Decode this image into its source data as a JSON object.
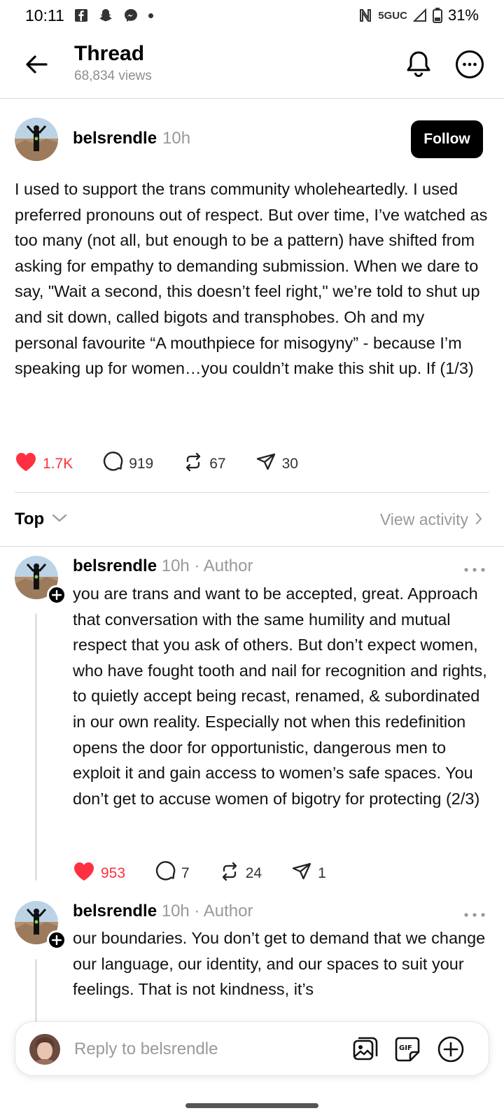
{
  "status_bar": {
    "time": "10:11",
    "network": "5GUC",
    "battery": "31%"
  },
  "header": {
    "title": "Thread",
    "views": "68,834 views"
  },
  "post": {
    "username": "belsrendle",
    "time": "10h",
    "follow_label": "Follow",
    "text": "I used to support the trans community wholeheartedly. I used preferred pronouns out of respect. But over time, I’ve watched as too many (not all, but enough to be a pattern) have shifted from asking for empathy to demanding submission. When we dare to say, \"Wait a second, this doesn’t feel right,\" we’re told to shut up and sit down, called bigots and transphobes. Oh and my personal favourite “A mouthpiece for misogyny” - because I’m speaking up for women…you couldn’t make this shit up. If (1/3)",
    "likes": "1.7K",
    "replies": "919",
    "reposts": "67",
    "shares": "30"
  },
  "sort": {
    "label": "Top",
    "view_activity": "View activity"
  },
  "replies": [
    {
      "username": "belsrendle",
      "meta": "10h · Author",
      "text": "you are trans and want to be accepted, great. Approach that conversation with the same humility and mutual respect that you ask of others. But don’t expect women, who have fought tooth and nail for recognition and rights, to quietly accept being recast, renamed, & subordinated in our own reality. Especially not when this redefinition opens the door for opportunistic, dangerous men to exploit it and gain access to women’s safe spaces. You don’t get to accuse women of bigotry for protecting (2/3)",
      "likes": "953",
      "replies": "7",
      "reposts": "24",
      "shares": "1"
    },
    {
      "username": "belsrendle",
      "meta": "10h · Author",
      "text": "our boundaries. You don’t get to demand that we change our language, our identity, and our spaces to suit your feelings. That is not kindness, it’s"
    }
  ],
  "composer": {
    "placeholder": "Reply to belsrendle"
  },
  "colors": {
    "like_red": "#ff3040",
    "meta_gray": "#999999",
    "accent_black": "#000000"
  }
}
